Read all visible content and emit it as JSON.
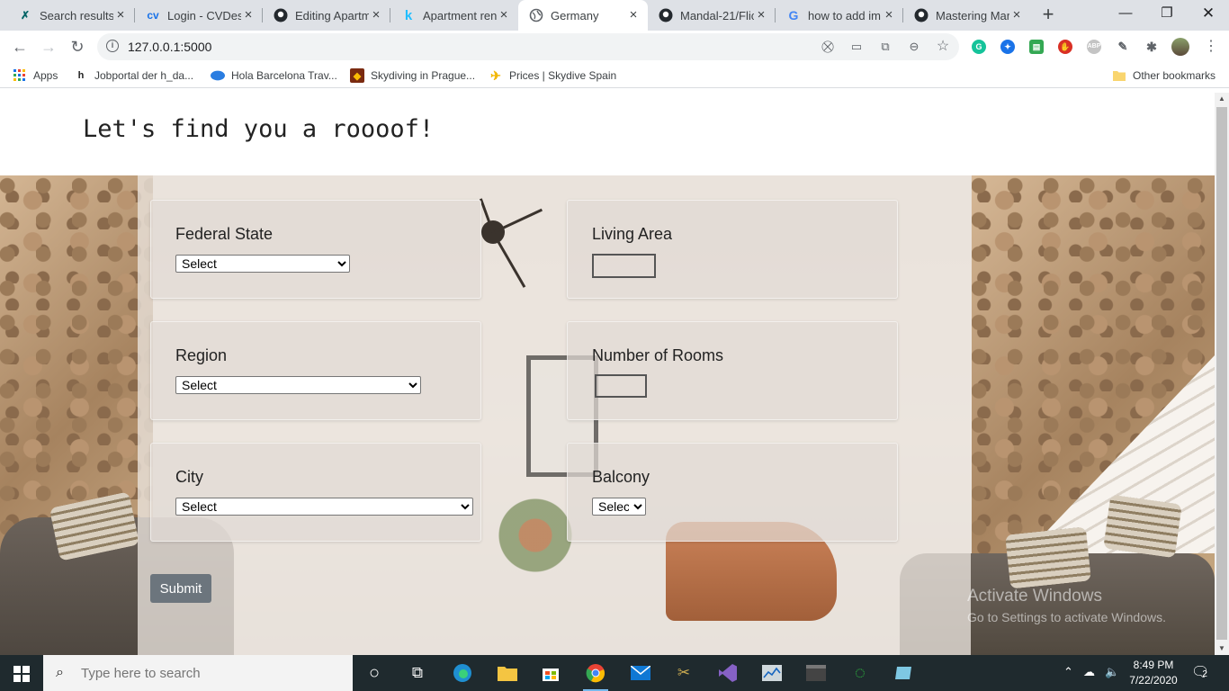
{
  "browser": {
    "tabs": [
      {
        "title": "Search results",
        "icon": "xing-icon",
        "color": "#026466"
      },
      {
        "title": "Login - CVDes",
        "icon": "cv-icon",
        "color": "#1a73e8"
      },
      {
        "title": "Editing Apartm",
        "icon": "github-icon",
        "color": "#24292e"
      },
      {
        "title": "Apartment ren",
        "icon": "kaggle-icon",
        "color": "#20beff"
      },
      {
        "title": "Germany",
        "icon": "globe-icon",
        "color": "#5f6368",
        "active": true
      },
      {
        "title": "Mandal-21/Flic",
        "icon": "github-icon",
        "color": "#24292e"
      },
      {
        "title": "how to add im",
        "icon": "google-icon",
        "color": "#4285f4"
      },
      {
        "title": "Mastering Mar",
        "icon": "github-icon",
        "color": "#24292e"
      }
    ],
    "url": "127.0.0.1:5000",
    "bookmarks": [
      {
        "label": "Apps",
        "icon": "apps-grid-icon"
      },
      {
        "label": "Jobportal der h_da...",
        "icon": "hda-icon"
      },
      {
        "label": "Hola Barcelona Trav...",
        "icon": "hola-icon"
      },
      {
        "label": "Skydiving in Prague...",
        "icon": "skydive-icon"
      },
      {
        "label": "Prices | Skydive Spain",
        "icon": "skydive-spain-icon"
      }
    ],
    "other_bookmarks": "Other bookmarks"
  },
  "page": {
    "title": "Let's find you a roooof!",
    "fields": {
      "federal_state": {
        "label": "Federal State",
        "value": "Select"
      },
      "living_area": {
        "label": "Living Area",
        "value": ""
      },
      "region": {
        "label": "Region",
        "value": "Select"
      },
      "rooms": {
        "label": "Number of Rooms",
        "value": ""
      },
      "city": {
        "label": "City",
        "value": "Select"
      },
      "balcony": {
        "label": "Balcony",
        "value": "Select"
      }
    },
    "submit_label": "Submit"
  },
  "watermark": {
    "line1": "Activate Windows",
    "line2": "Go to Settings to activate Windows."
  },
  "taskbar": {
    "search_placeholder": "Type here to search",
    "time": "8:49 PM",
    "date": "7/22/2020",
    "notifications": "2"
  }
}
